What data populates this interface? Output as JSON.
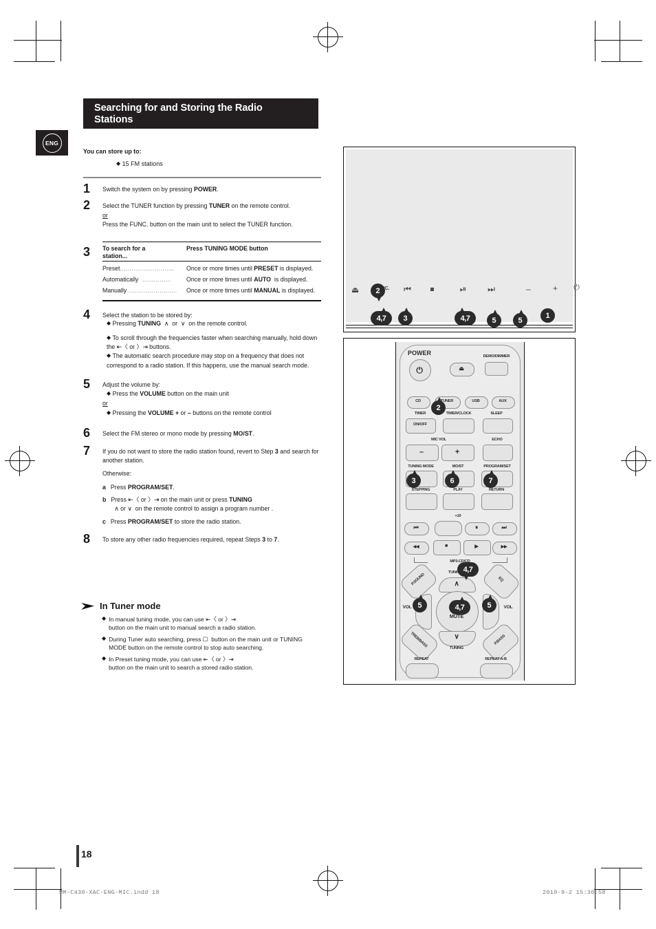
{
  "language_badge": "ENG",
  "header": {
    "title_line1": "Searching for and Storing the Radio",
    "title_line2": "Stations"
  },
  "intro": {
    "title": "You can store up to:",
    "item": "15 FM stations"
  },
  "steps": [
    {
      "num": "1",
      "text_html": "Switch the system on by pressing <b>POWER</b>."
    },
    {
      "num": "2",
      "line1_html": "Select the TUNER function by pressing <b>TUNER</b> on the remote control.",
      "or": "or",
      "line2_html": "Press the FUNC. button on the main unit to select the TUNER function."
    },
    {
      "num": "3",
      "table": {
        "col1_header_line1": "To search for a",
        "col1_header_line2": "station...",
        "col2_header": "Press TUNING MODE button",
        "rows": [
          {
            "label": "Preset",
            "value_html": "Once or more times until <b>PRESET</b> is displayed."
          },
          {
            "label": "Automatically",
            "value_html": "Once or more times until <b>AUTO</b>&nbsp; is displayed."
          },
          {
            "label": "Manually",
            "value_html": "Once or more times until <b>MANUAL</b> is displayed."
          }
        ]
      }
    },
    {
      "num": "4",
      "lead": "Select the station to be stored by:",
      "bullets_html": [
        "Pressing <b>TUNING</b> &nbsp;&#8743;&nbsp; or &nbsp;&#8744;&nbsp; on the remote control.",
        "To scroll through the frequencies faster when searching manually, hold down the &#8676;&#9001; or &#9002;&#8677; buttons.",
        "The automatic search procedure may stop on a frequency that does not correspond to a radio station. If this happens, use the manual search mode."
      ]
    },
    {
      "num": "5",
      "lead": "Adjust the volume by:",
      "bullet1_html": "Press the <b>VOLUME</b> button on the main unit",
      "or": "or",
      "bullet2_html": "Pressing the <b>VOLUME</b> <b>+</b> or <b>&#8211;</b> buttons on the remote control"
    },
    {
      "num": "6",
      "text_html": "Select the FM stereo or mono mode by pressing <b>MO/ST</b>."
    },
    {
      "num": "7",
      "line1_html": "If you do not want to store the radio station found, revert to Step <b>3</b> and search for another station.",
      "otherwise": "Otherwise:",
      "subs": [
        {
          "k": "a",
          "text_html": "Press <b>PROGRAM/SET</b>."
        },
        {
          "k": "b",
          "text_html": "Press &#8676;&#9001; or &#9002;&#8677; on the main unit or press <b>TUNING</b><br>&nbsp;&nbsp;&#8743; or &#8744;&nbsp; on the remote control to assign a program number ."
        },
        {
          "k": "c",
          "text_html": "Press <b>PROGRAM/SET</b> to store the radio station."
        }
      ]
    },
    {
      "num": "8",
      "text_html": "To store any other radio frequencies required, repeat Steps <b>3</b> to <b>7</b>."
    }
  ],
  "tuner_mode": {
    "heading": "In Tuner mode",
    "notes_html": [
      "In manual tuning mode, you can use &#8676;&#9001; or &#9002;&#8677;<br>button on the main unit to manual search a radio station.",
      "During Tuner auto searching, press &#9744;&nbsp; button on the main unit or TUNING MODE button on the remote control to stop auto searching.",
      "In Preset tuning mode, you can use &#8676;&#9001; or &#9002;&#8677;<br>button on the main unit to search a stored radio station."
    ]
  },
  "main_unit_panel": {
    "buttons": [
      {
        "name": "eject",
        "glyph": "⏏",
        "label": ""
      },
      {
        "name": "func",
        "glyph": "",
        "label": "FUNC."
      },
      {
        "name": "prev-track",
        "glyph": "⏮",
        "label": ""
      },
      {
        "name": "stop",
        "glyph": "⏹",
        "label": ""
      },
      {
        "name": "play-pause",
        "glyph": "⏯",
        "label": ""
      },
      {
        "name": "next-track",
        "glyph": "⏭",
        "label": ""
      },
      {
        "name": "volume-down",
        "glyph": "–",
        "label": ""
      },
      {
        "name": "volume-up",
        "glyph": "+",
        "label": ""
      },
      {
        "name": "power",
        "glyph": "⏻",
        "label": ""
      }
    ],
    "callouts": [
      {
        "text": "2",
        "target": "func"
      },
      {
        "text": "4,7",
        "target": "prev-track"
      },
      {
        "text": "3",
        "target": "stop"
      },
      {
        "text": "4,7",
        "target": "next-track"
      },
      {
        "text": "5",
        "target": "volume-down"
      },
      {
        "text": "5",
        "target": "volume-up"
      },
      {
        "text": "1",
        "target": "power"
      }
    ]
  },
  "remote_panel": {
    "labels": {
      "power": "POWER",
      "eject": "⏏",
      "demo_dimmer": "DEMO/DIMMER",
      "cd": "CD",
      "tuner": "TUNER",
      "usb": "USB",
      "aux": "AUX",
      "timer_onoff_top": "TIMER",
      "timer_onoff": "ON/OFF",
      "timer_clock": "TIMER/CLOCK",
      "sleep": "SLEEP",
      "mic_vol": "MIC VOL",
      "mic_minus": "–",
      "mic_plus": "+",
      "echo": "ECHO",
      "tuning_mode": "TUNING MODE",
      "most": "MO/ST",
      "program_set": "PROGRAM/SET",
      "stepping": "STEPPING",
      "play": "PLAY",
      "return": "RETURN",
      "plus10": "+10",
      "skip_back": "⏮",
      "pause": "⏸",
      "skip_fwd": "⏭",
      "rew": "◀◀",
      "stop": "■",
      "play_icon": "▶",
      "ff": "▶▶",
      "mp3_cd": "MP3-CD/CD",
      "psound": "P.SOUND",
      "eq": "EQ",
      "tuning_up": "TUNING",
      "tuning_down": "TUNING",
      "vol_left": "VOL",
      "vol_right": "VOL",
      "vol_minus": "–",
      "vol_plus": "+",
      "mute": "MUTE",
      "treble_bass": "TREB/BASS",
      "pbass": "P.BASS",
      "repeat": "REPEAT",
      "repeat_ab": "REPEAT A-B"
    },
    "callouts": [
      {
        "text": "2",
        "target": "tuner"
      },
      {
        "text": "3",
        "target": "tuning-mode"
      },
      {
        "text": "6",
        "target": "most"
      },
      {
        "text": "7",
        "target": "program-set"
      },
      {
        "text": "4,7",
        "target": "tuning-up"
      },
      {
        "text": "4,7",
        "target": "tuning-down"
      },
      {
        "text": "5",
        "target": "vol-minus"
      },
      {
        "text": "5",
        "target": "vol-plus"
      }
    ]
  },
  "footer": {
    "page_number": "18",
    "file": "MM-C430-XAC-ENG-MIC.indd    18",
    "date": "2010-9-2    15:30:58"
  }
}
